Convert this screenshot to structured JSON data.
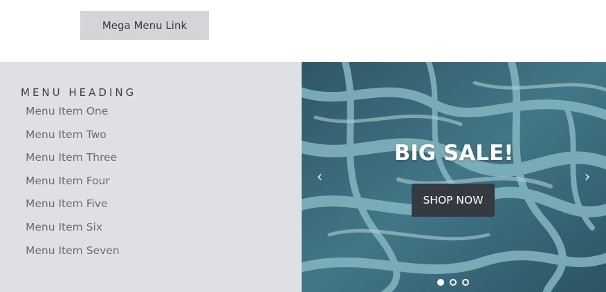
{
  "mega_link": {
    "label": "Mega Menu Link"
  },
  "menu": {
    "heading": "MENU HEADING",
    "items": [
      "Menu Item One",
      "Menu Item Two",
      "Menu Item Three",
      "Menu Item Four",
      "Menu Item Five",
      "Menu Item Six",
      "Menu Item Seven"
    ]
  },
  "carousel": {
    "title": "BIG SALE!",
    "button_label": "SHOP NOW",
    "prev_icon": "chevron-left-icon",
    "next_icon": "chevron-right-icon",
    "slide_count": 3,
    "active_slide": 1
  },
  "colors": {
    "link_bg": "#d3d5d9",
    "panel_bg": "#dee0e3",
    "button_bg": "#343a40",
    "image_tone": "#3e6f80"
  }
}
